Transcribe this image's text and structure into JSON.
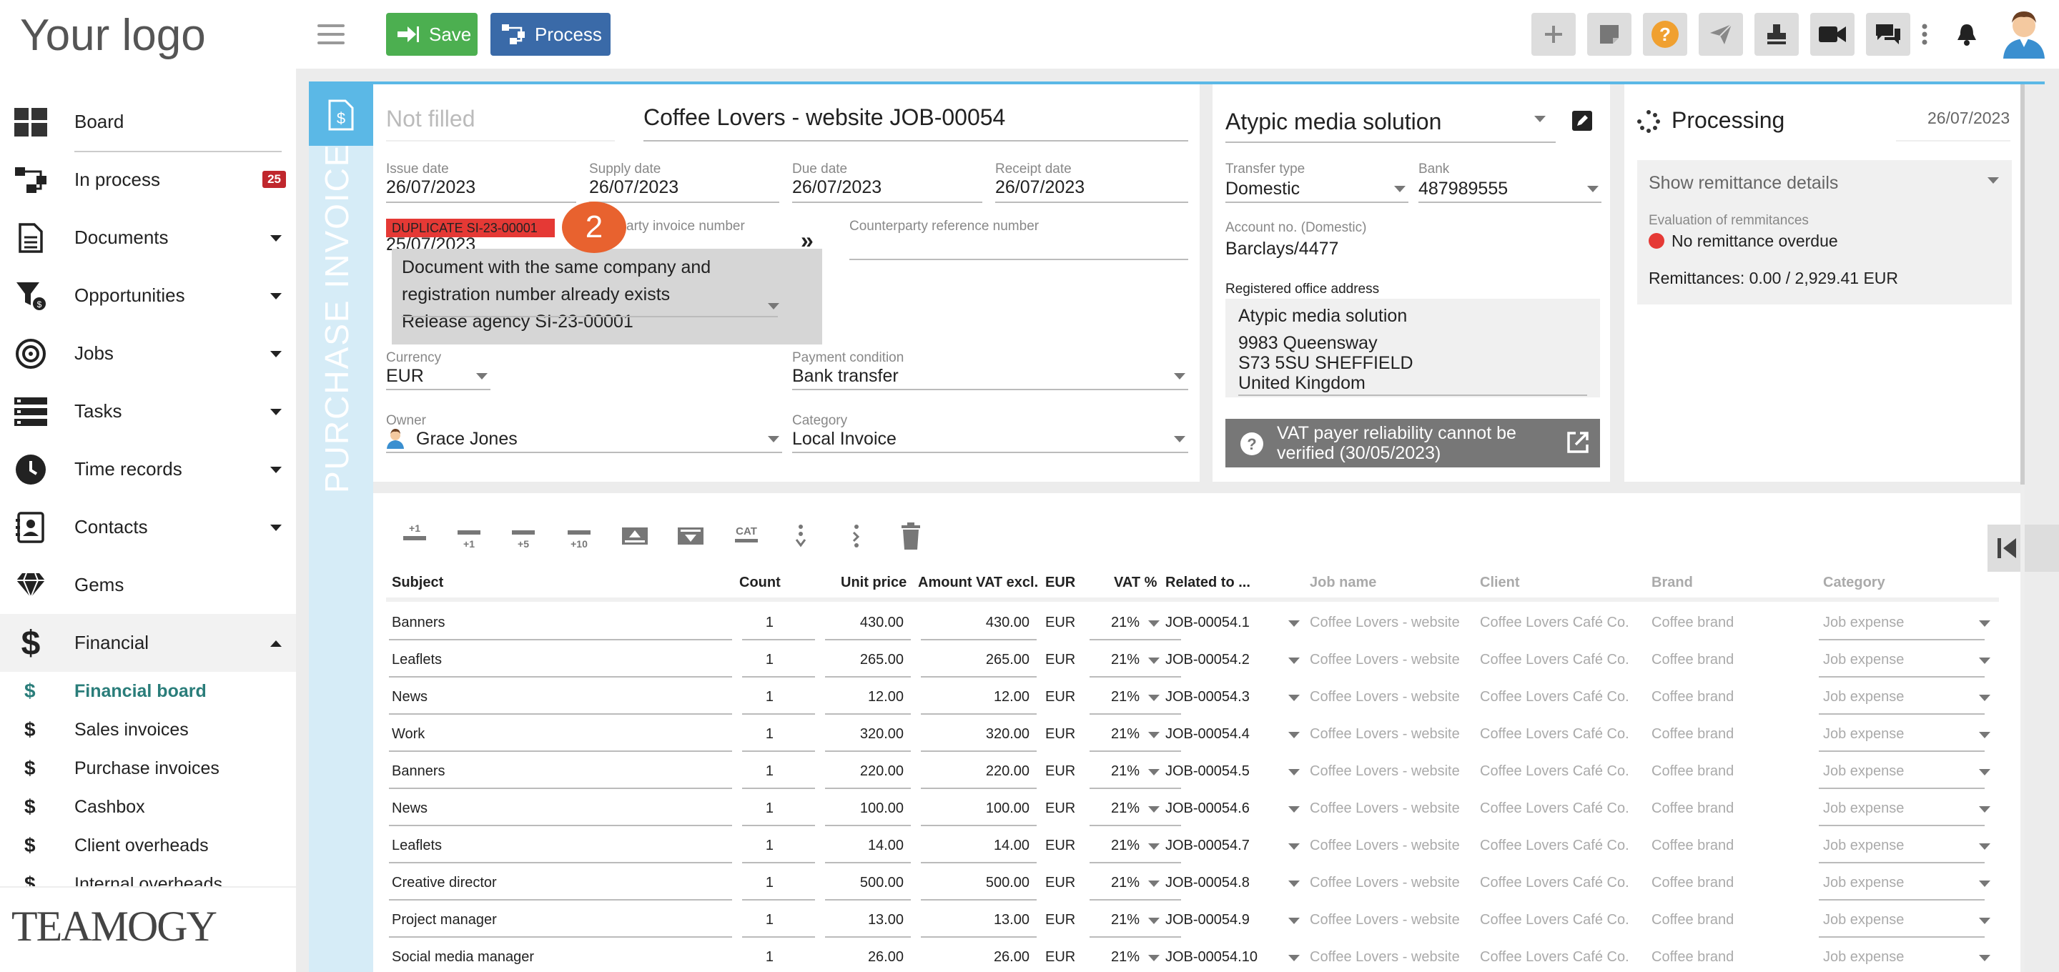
{
  "logo_text": "Your logo",
  "sidebar": {
    "items": [
      {
        "label": "Board",
        "icon": "board-icon"
      },
      {
        "label": "In process",
        "icon": "process-icon",
        "badge": "25"
      },
      {
        "label": "Documents",
        "icon": "document-icon"
      },
      {
        "label": "Opportunities",
        "icon": "opportunities-icon"
      },
      {
        "label": "Jobs",
        "icon": "jobs-icon"
      },
      {
        "label": "Tasks",
        "icon": "tasks-icon"
      },
      {
        "label": "Time records",
        "icon": "clock-icon"
      },
      {
        "label": "Contacts",
        "icon": "contacts-icon"
      },
      {
        "label": "Gems",
        "icon": "gem-icon"
      },
      {
        "label": "Financial",
        "icon": "dollar-icon"
      }
    ],
    "financial_sub": [
      "Financial board",
      "Sales invoices",
      "Purchase invoices",
      "Cashbox",
      "Client overheads",
      "Internal overheads"
    ],
    "footer_logo": "TEAMOGY"
  },
  "toolbar": {
    "save_label": "Save",
    "process_label": "Process"
  },
  "doc": {
    "vertical_title": "PURCHASE INVOICE",
    "status_placeholder": "Not filled",
    "title": "Coffee Lovers - website JOB-00054",
    "issue_date_label": "Issue date",
    "issue_date": "26/07/2023",
    "supply_date_label": "Supply date",
    "supply_date": "26/07/2023",
    "due_date_label": "Due date",
    "due_date": "26/07/2023",
    "receipt_date_label": "Receipt date",
    "receipt_date": "26/07/2023",
    "duplicate_badge": "DUPLICATE SI-23-00001",
    "partial_date": "25/07/2023",
    "counterparty_invoice_label": "arty invoice number",
    "counterparty_ref_label": "Counterparty reference number",
    "step_number": "2",
    "tooltip_line1": "Document with the same company and",
    "tooltip_line2": "registration number already exists",
    "tooltip_line3": "Release agency SI-23-00001",
    "currency_label": "Currency",
    "currency": "EUR",
    "payment_label": "Payment condition",
    "payment": "Bank transfer",
    "owner_label": "Owner",
    "owner": "Grace Jones",
    "category_label": "Category",
    "category": "Local Invoice"
  },
  "supplier": {
    "name": "Atypic media solution",
    "transfer_label": "Transfer type",
    "transfer": "Domestic",
    "bank_label": "Bank",
    "bank": "487989555",
    "account_label": "Account no. (Domestic)",
    "account": "Barclays/4477",
    "address_label": "Registered office address",
    "address": [
      "Atypic media solution",
      "9983 Queensway",
      "S73 5SU SHEFFIELD",
      "United Kingdom"
    ],
    "vat_line1": "VAT payer reliability cannot be",
    "vat_line2": "verified (30/05/2023)"
  },
  "status": {
    "label": "Processing",
    "date": "26/07/2023",
    "remittance_details": "Show remittance details",
    "evaluation_label": "Evaluation of remmitances",
    "evaluation": "No remittance overdue",
    "remittances": "Remittances: 0.00 / 2,929.41 EUR"
  },
  "item_toolbar": {
    "plus1": "+1",
    "cat": "CAT"
  },
  "table": {
    "headers": {
      "subject": "Subject",
      "count": "Count",
      "unit": "Unit price",
      "amount": "Amount VAT excl.",
      "cur": "EUR",
      "vat": "VAT %",
      "related": "Related to ...",
      "job": "Job name",
      "client": "Client",
      "brand": "Brand",
      "category": "Category"
    },
    "rows": [
      {
        "subject": "Banners",
        "count": "1",
        "unit": "430.00",
        "amount": "430.00",
        "cur": "EUR",
        "vat": "21%",
        "related": "JOB-00054.1",
        "job": "Coffee Lovers - website",
        "client": "Coffee Lovers Café Co.",
        "brand": "Coffee brand",
        "category": "Job expense"
      },
      {
        "subject": "Leaflets",
        "count": "1",
        "unit": "265.00",
        "amount": "265.00",
        "cur": "EUR",
        "vat": "21%",
        "related": "JOB-00054.2",
        "job": "Coffee Lovers - website",
        "client": "Coffee Lovers Café Co.",
        "brand": "Coffee brand",
        "category": "Job expense"
      },
      {
        "subject": "News",
        "count": "1",
        "unit": "12.00",
        "amount": "12.00",
        "cur": "EUR",
        "vat": "21%",
        "related": "JOB-00054.3",
        "job": "Coffee Lovers - website",
        "client": "Coffee Lovers Café Co.",
        "brand": "Coffee brand",
        "category": "Job expense"
      },
      {
        "subject": "Work",
        "count": "1",
        "unit": "320.00",
        "amount": "320.00",
        "cur": "EUR",
        "vat": "21%",
        "related": "JOB-00054.4",
        "job": "Coffee Lovers - website",
        "client": "Coffee Lovers Café Co.",
        "brand": "Coffee brand",
        "category": "Job expense"
      },
      {
        "subject": "Banners",
        "count": "1",
        "unit": "220.00",
        "amount": "220.00",
        "cur": "EUR",
        "vat": "21%",
        "related": "JOB-00054.5",
        "job": "Coffee Lovers - website",
        "client": "Coffee Lovers Café Co.",
        "brand": "Coffee brand",
        "category": "Job expense"
      },
      {
        "subject": "News",
        "count": "1",
        "unit": "100.00",
        "amount": "100.00",
        "cur": "EUR",
        "vat": "21%",
        "related": "JOB-00054.6",
        "job": "Coffee Lovers - website",
        "client": "Coffee Lovers Café Co.",
        "brand": "Coffee brand",
        "category": "Job expense"
      },
      {
        "subject": "Leaflets",
        "count": "1",
        "unit": "14.00",
        "amount": "14.00",
        "cur": "EUR",
        "vat": "21%",
        "related": "JOB-00054.7",
        "job": "Coffee Lovers - website",
        "client": "Coffee Lovers Café Co.",
        "brand": "Coffee brand",
        "category": "Job expense"
      },
      {
        "subject": "Creative director",
        "count": "1",
        "unit": "500.00",
        "amount": "500.00",
        "cur": "EUR",
        "vat": "21%",
        "related": "JOB-00054.8",
        "job": "Coffee Lovers - website",
        "client": "Coffee Lovers Café Co.",
        "brand": "Coffee brand",
        "category": "Job expense"
      },
      {
        "subject": "Project manager",
        "count": "1",
        "unit": "13.00",
        "amount": "13.00",
        "cur": "EUR",
        "vat": "21%",
        "related": "JOB-00054.9",
        "job": "Coffee Lovers - website",
        "client": "Coffee Lovers Café Co.",
        "brand": "Coffee brand",
        "category": "Job expense"
      },
      {
        "subject": "Social media manager",
        "count": "1",
        "unit": "26.00",
        "amount": "26.00",
        "cur": "EUR",
        "vat": "21%",
        "related": "JOB-00054.10",
        "job": "Coffee Lovers - website",
        "client": "Coffee Lovers Café Co.",
        "brand": "Coffee brand",
        "category": "Job expense"
      }
    ]
  },
  "colors": {
    "save": "#4caf50",
    "process": "#3a6aa8",
    "accent": "#5bb8e6",
    "badge": "#c0272d",
    "duplicate": "#e53935",
    "step": "#e8622f"
  }
}
